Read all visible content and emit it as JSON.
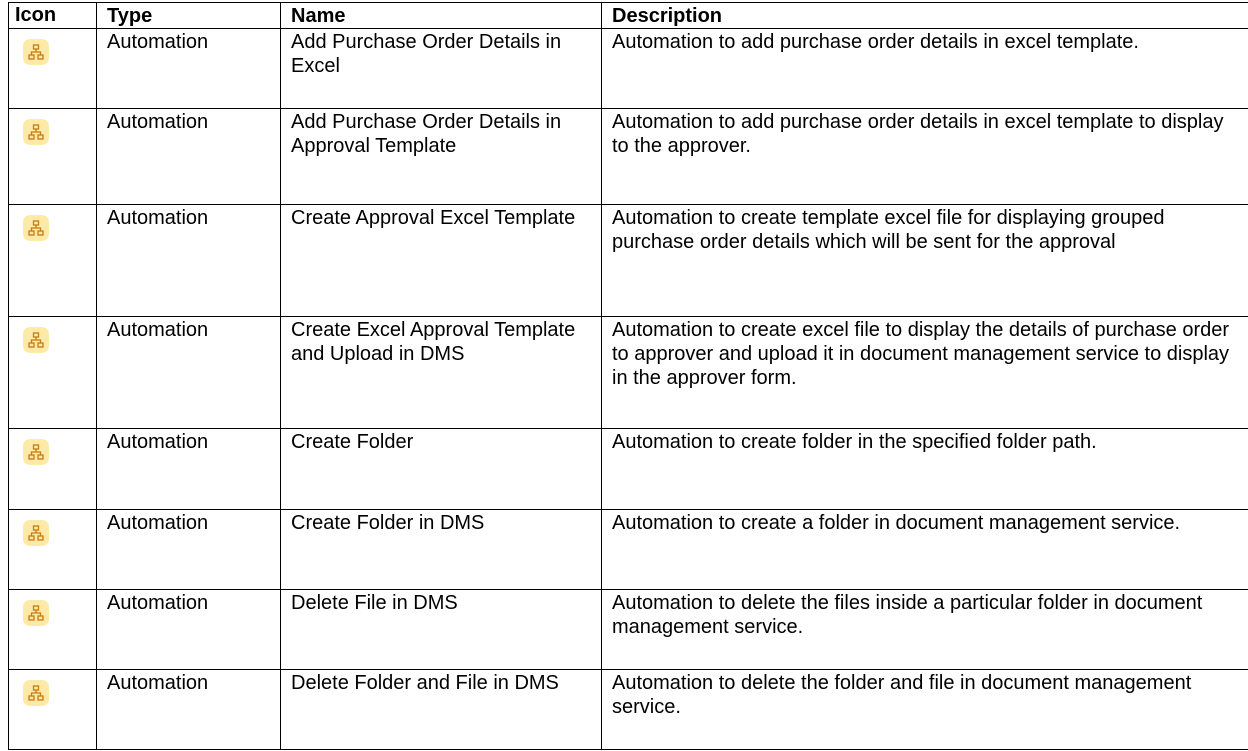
{
  "table": {
    "headers": {
      "icon": "Icon",
      "type": "Type",
      "name": "Name",
      "description": "Description"
    },
    "rows": [
      {
        "icon": "automation-flow-icon",
        "type": "Automation",
        "name": "Add Purchase Order Details in Excel",
        "description": "Automation to add purchase order details in excel template."
      },
      {
        "icon": "automation-flow-icon",
        "type": "Automation",
        "name": "Add Purchase Order Details in Approval Template",
        "description": "Automation to add purchase order details in excel template to display to the approver."
      },
      {
        "icon": "automation-flow-icon",
        "type": "Automation",
        "name": "Create Approval Excel Template",
        "description": "Automation to create template excel file for displaying grouped purchase order details which will be sent for the approval"
      },
      {
        "icon": "automation-flow-icon",
        "type": "Automation",
        "name": "Create Excel Approval Template and Upload in DMS",
        "description": "Automation to create excel file to display the details of purchase order to approver and upload it in document management service to display in the approver form."
      },
      {
        "icon": "automation-flow-icon",
        "type": "Automation",
        "name": "Create Folder",
        "description": "Automation to create folder in the specified folder path."
      },
      {
        "icon": "automation-flow-icon",
        "type": "Automation",
        "name": "Create Folder in DMS",
        "description": "Automation to create a folder in document management service."
      },
      {
        "icon": "automation-flow-icon",
        "type": "Automation",
        "name": "Delete File in DMS",
        "description": "Automation to delete the files inside a particular folder in document management service."
      },
      {
        "icon": "automation-flow-icon",
        "type": "Automation",
        "name": "Delete Folder and File in DMS",
        "description": "Automation to delete the folder and file in document management service."
      }
    ]
  },
  "colors": {
    "icon_background": "#fde9a8",
    "icon_stroke": "#c97a12",
    "border": "#000000"
  }
}
